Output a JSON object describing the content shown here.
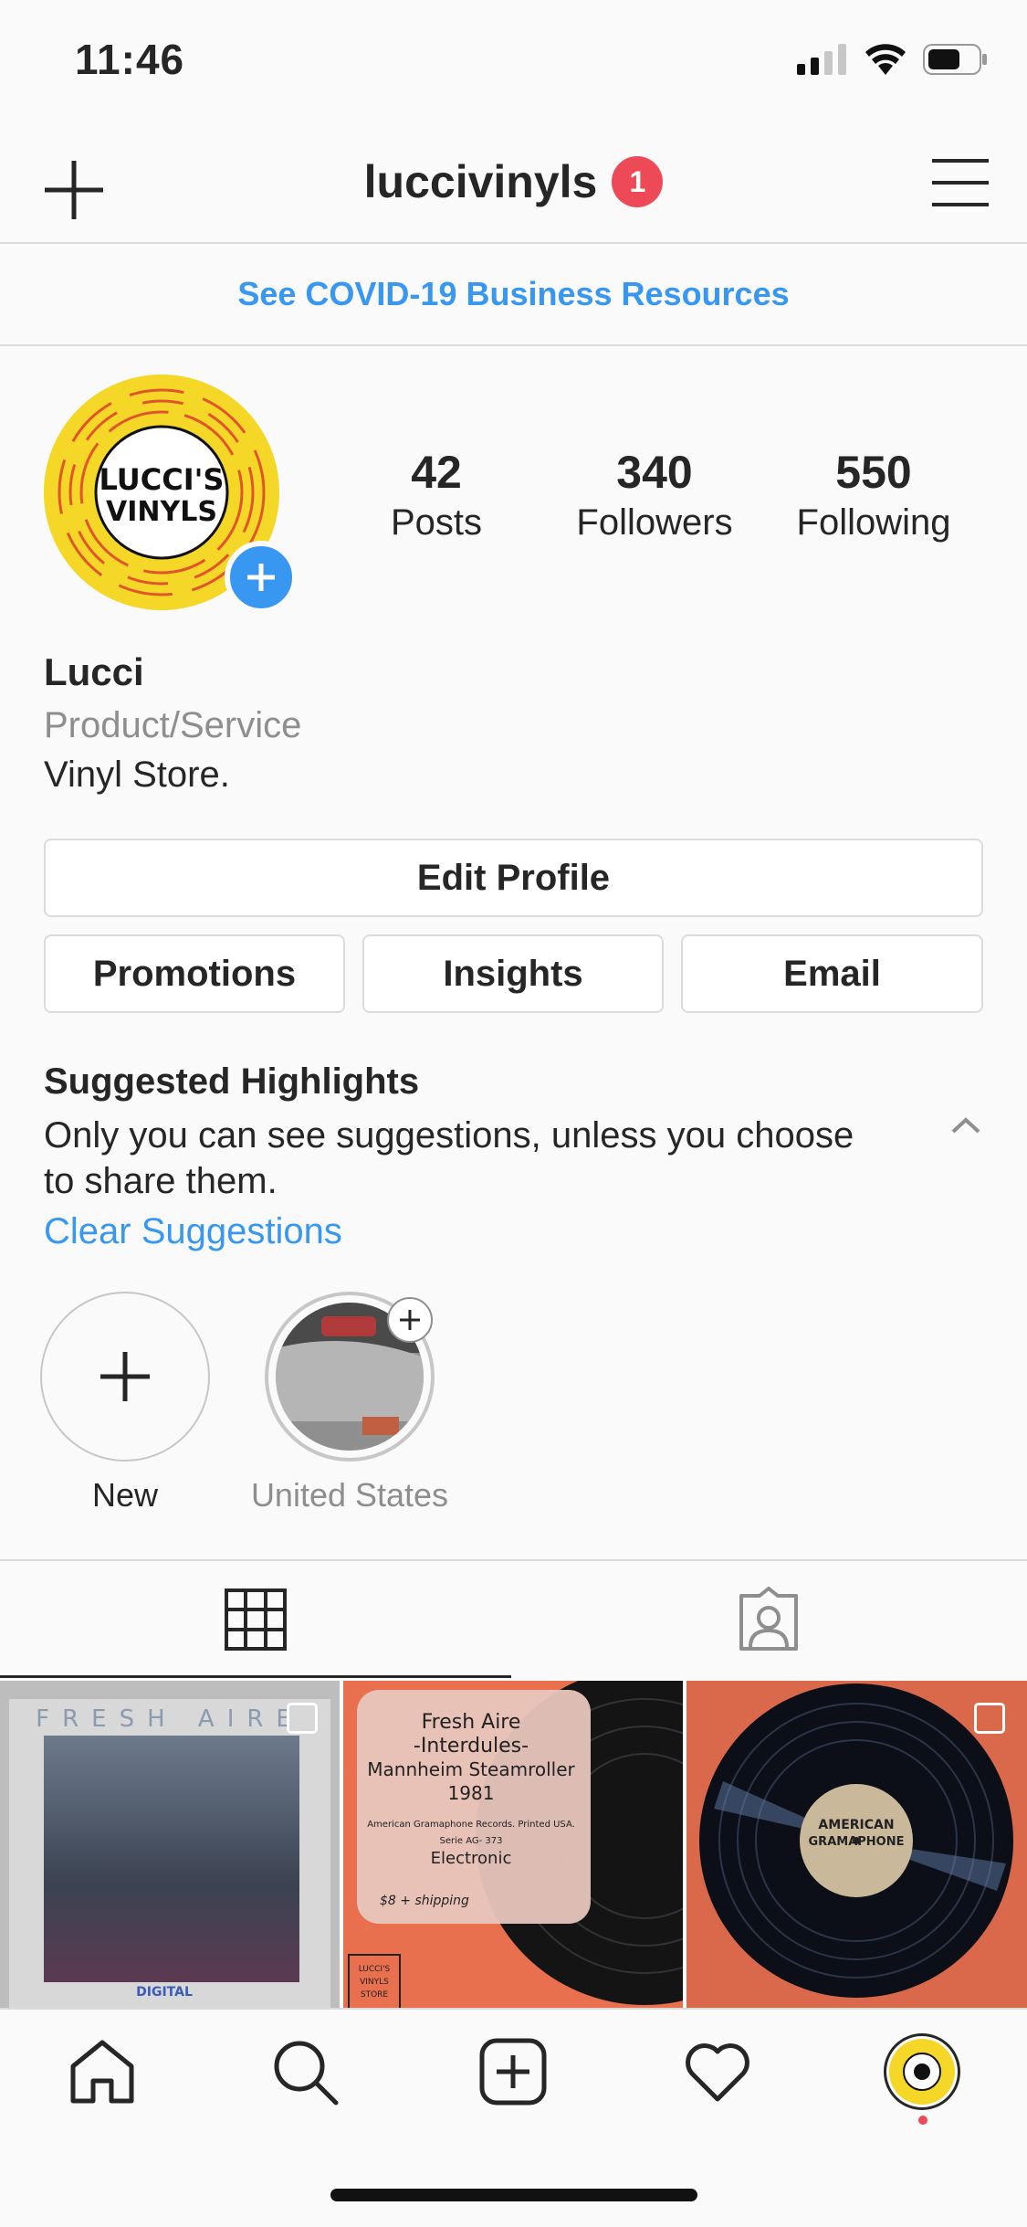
{
  "status_bar": {
    "time": "11:46"
  },
  "header": {
    "username": "luccivinyls",
    "notification_count": "1"
  },
  "banner": {
    "text": "See COVID-19 Business Resources"
  },
  "profile": {
    "avatar_text_line1": "LUCCI'S",
    "avatar_text_line2": "VINYLS",
    "stats": [
      {
        "value": "42",
        "label": "Posts"
      },
      {
        "value": "340",
        "label": "Followers"
      },
      {
        "value": "550",
        "label": "Following"
      }
    ],
    "name": "Lucci",
    "category": "Product/Service",
    "bio": "Vinyl Store."
  },
  "buttons": {
    "edit_profile": "Edit Profile",
    "promotions": "Promotions",
    "insights": "Insights",
    "email": "Email"
  },
  "highlights": {
    "title": "Suggested Highlights",
    "description": "Only you can see suggestions, unless you choose to share them.",
    "clear_label": "Clear Suggestions",
    "items": [
      {
        "label": "New"
      },
      {
        "label": "United States"
      }
    ]
  },
  "posts": [
    {
      "title_text": "FRESH AIRE",
      "footer_text": "DIGITAL"
    },
    {
      "line1": "Fresh Aire",
      "line2": "-Interdules-",
      "line3": "Mannheim Steamroller",
      "line4": "1981",
      "line5": "American Gramaphone Records. Printed USA.",
      "line6": "Serie AG- 373",
      "line7": "Electronic",
      "price": "$8 + shipping",
      "store_line1": "LUCCI'S",
      "store_line2": "VINYLS",
      "store_line3": "STORE"
    },
    {
      "label_line1": "AMERICAN",
      "label_line2": "GRAMAPHONE"
    }
  ],
  "colors": {
    "accent_blue": "#3897f0",
    "badge_red": "#ed4956",
    "avatar_yellow": "#f5d728"
  }
}
